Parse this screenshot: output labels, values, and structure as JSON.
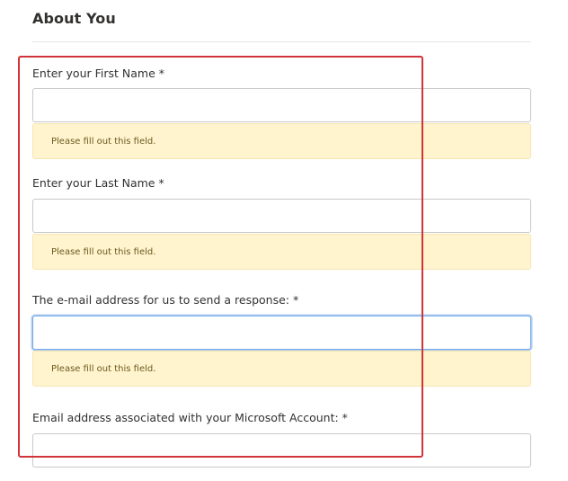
{
  "section": {
    "title": "About You"
  },
  "fields": {
    "first_name": {
      "label": "Enter your First Name *",
      "value": "",
      "warning": "Please fill out this field."
    },
    "last_name": {
      "label": "Enter your Last Name *",
      "value": "",
      "warning": "Please fill out this field."
    },
    "response_email": {
      "label": "The e-mail address for us to send a response: *",
      "value": "",
      "warning": "Please fill out this field."
    },
    "microsoft_email": {
      "label": "Email address associated with your Microsoft Account: *",
      "value": ""
    }
  },
  "colors": {
    "highlight_border": "#d13438",
    "warning_background": "#fff4ce",
    "focus_border": "#73a7e6"
  }
}
